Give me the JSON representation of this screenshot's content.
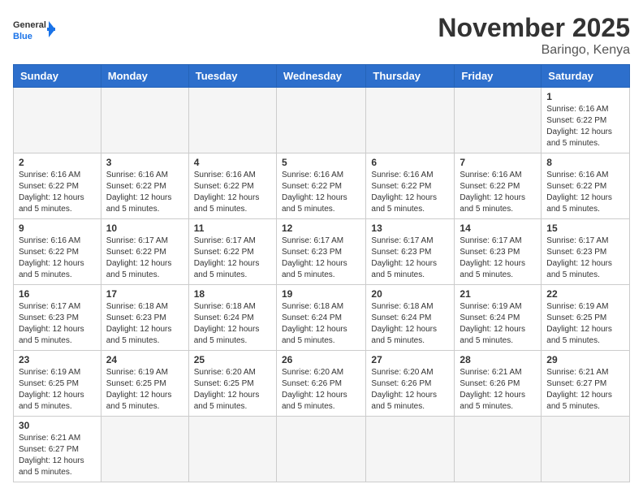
{
  "header": {
    "logo_general": "General",
    "logo_blue": "Blue",
    "month_title": "November 2025",
    "location": "Baringo, Kenya"
  },
  "days_of_week": [
    "Sunday",
    "Monday",
    "Tuesday",
    "Wednesday",
    "Thursday",
    "Friday",
    "Saturday"
  ],
  "weeks": [
    {
      "days": [
        {
          "num": "",
          "empty": true
        },
        {
          "num": "",
          "empty": true
        },
        {
          "num": "",
          "empty": true
        },
        {
          "num": "",
          "empty": true
        },
        {
          "num": "",
          "empty": true
        },
        {
          "num": "",
          "empty": true
        },
        {
          "num": "1",
          "sunrise": "6:16 AM",
          "sunset": "6:22 PM",
          "daylight": "12 hours and 5 minutes."
        }
      ]
    },
    {
      "days": [
        {
          "num": "2",
          "sunrise": "6:16 AM",
          "sunset": "6:22 PM",
          "daylight": "12 hours and 5 minutes."
        },
        {
          "num": "3",
          "sunrise": "6:16 AM",
          "sunset": "6:22 PM",
          "daylight": "12 hours and 5 minutes."
        },
        {
          "num": "4",
          "sunrise": "6:16 AM",
          "sunset": "6:22 PM",
          "daylight": "12 hours and 5 minutes."
        },
        {
          "num": "5",
          "sunrise": "6:16 AM",
          "sunset": "6:22 PM",
          "daylight": "12 hours and 5 minutes."
        },
        {
          "num": "6",
          "sunrise": "6:16 AM",
          "sunset": "6:22 PM",
          "daylight": "12 hours and 5 minutes."
        },
        {
          "num": "7",
          "sunrise": "6:16 AM",
          "sunset": "6:22 PM",
          "daylight": "12 hours and 5 minutes."
        },
        {
          "num": "8",
          "sunrise": "6:16 AM",
          "sunset": "6:22 PM",
          "daylight": "12 hours and 5 minutes."
        }
      ]
    },
    {
      "days": [
        {
          "num": "9",
          "sunrise": "6:16 AM",
          "sunset": "6:22 PM",
          "daylight": "12 hours and 5 minutes."
        },
        {
          "num": "10",
          "sunrise": "6:17 AM",
          "sunset": "6:22 PM",
          "daylight": "12 hours and 5 minutes."
        },
        {
          "num": "11",
          "sunrise": "6:17 AM",
          "sunset": "6:22 PM",
          "daylight": "12 hours and 5 minutes."
        },
        {
          "num": "12",
          "sunrise": "6:17 AM",
          "sunset": "6:23 PM",
          "daylight": "12 hours and 5 minutes."
        },
        {
          "num": "13",
          "sunrise": "6:17 AM",
          "sunset": "6:23 PM",
          "daylight": "12 hours and 5 minutes."
        },
        {
          "num": "14",
          "sunrise": "6:17 AM",
          "sunset": "6:23 PM",
          "daylight": "12 hours and 5 minutes."
        },
        {
          "num": "15",
          "sunrise": "6:17 AM",
          "sunset": "6:23 PM",
          "daylight": "12 hours and 5 minutes."
        }
      ]
    },
    {
      "days": [
        {
          "num": "16",
          "sunrise": "6:17 AM",
          "sunset": "6:23 PM",
          "daylight": "12 hours and 5 minutes."
        },
        {
          "num": "17",
          "sunrise": "6:18 AM",
          "sunset": "6:23 PM",
          "daylight": "12 hours and 5 minutes."
        },
        {
          "num": "18",
          "sunrise": "6:18 AM",
          "sunset": "6:24 PM",
          "daylight": "12 hours and 5 minutes."
        },
        {
          "num": "19",
          "sunrise": "6:18 AM",
          "sunset": "6:24 PM",
          "daylight": "12 hours and 5 minutes."
        },
        {
          "num": "20",
          "sunrise": "6:18 AM",
          "sunset": "6:24 PM",
          "daylight": "12 hours and 5 minutes."
        },
        {
          "num": "21",
          "sunrise": "6:19 AM",
          "sunset": "6:24 PM",
          "daylight": "12 hours and 5 minutes."
        },
        {
          "num": "22",
          "sunrise": "6:19 AM",
          "sunset": "6:25 PM",
          "daylight": "12 hours and 5 minutes."
        }
      ]
    },
    {
      "days": [
        {
          "num": "23",
          "sunrise": "6:19 AM",
          "sunset": "6:25 PM",
          "daylight": "12 hours and 5 minutes."
        },
        {
          "num": "24",
          "sunrise": "6:19 AM",
          "sunset": "6:25 PM",
          "daylight": "12 hours and 5 minutes."
        },
        {
          "num": "25",
          "sunrise": "6:20 AM",
          "sunset": "6:25 PM",
          "daylight": "12 hours and 5 minutes."
        },
        {
          "num": "26",
          "sunrise": "6:20 AM",
          "sunset": "6:26 PM",
          "daylight": "12 hours and 5 minutes."
        },
        {
          "num": "27",
          "sunrise": "6:20 AM",
          "sunset": "6:26 PM",
          "daylight": "12 hours and 5 minutes."
        },
        {
          "num": "28",
          "sunrise": "6:21 AM",
          "sunset": "6:26 PM",
          "daylight": "12 hours and 5 minutes."
        },
        {
          "num": "29",
          "sunrise": "6:21 AM",
          "sunset": "6:27 PM",
          "daylight": "12 hours and 5 minutes."
        }
      ]
    },
    {
      "days": [
        {
          "num": "30",
          "sunrise": "6:21 AM",
          "sunset": "6:27 PM",
          "daylight": "12 hours and 5 minutes."
        },
        {
          "num": "",
          "empty": true
        },
        {
          "num": "",
          "empty": true
        },
        {
          "num": "",
          "empty": true
        },
        {
          "num": "",
          "empty": true
        },
        {
          "num": "",
          "empty": true
        },
        {
          "num": "",
          "empty": true
        }
      ]
    }
  ],
  "labels": {
    "sunrise_label": "Sunrise:",
    "sunset_label": "Sunset:",
    "daylight_label": "Daylight:"
  }
}
